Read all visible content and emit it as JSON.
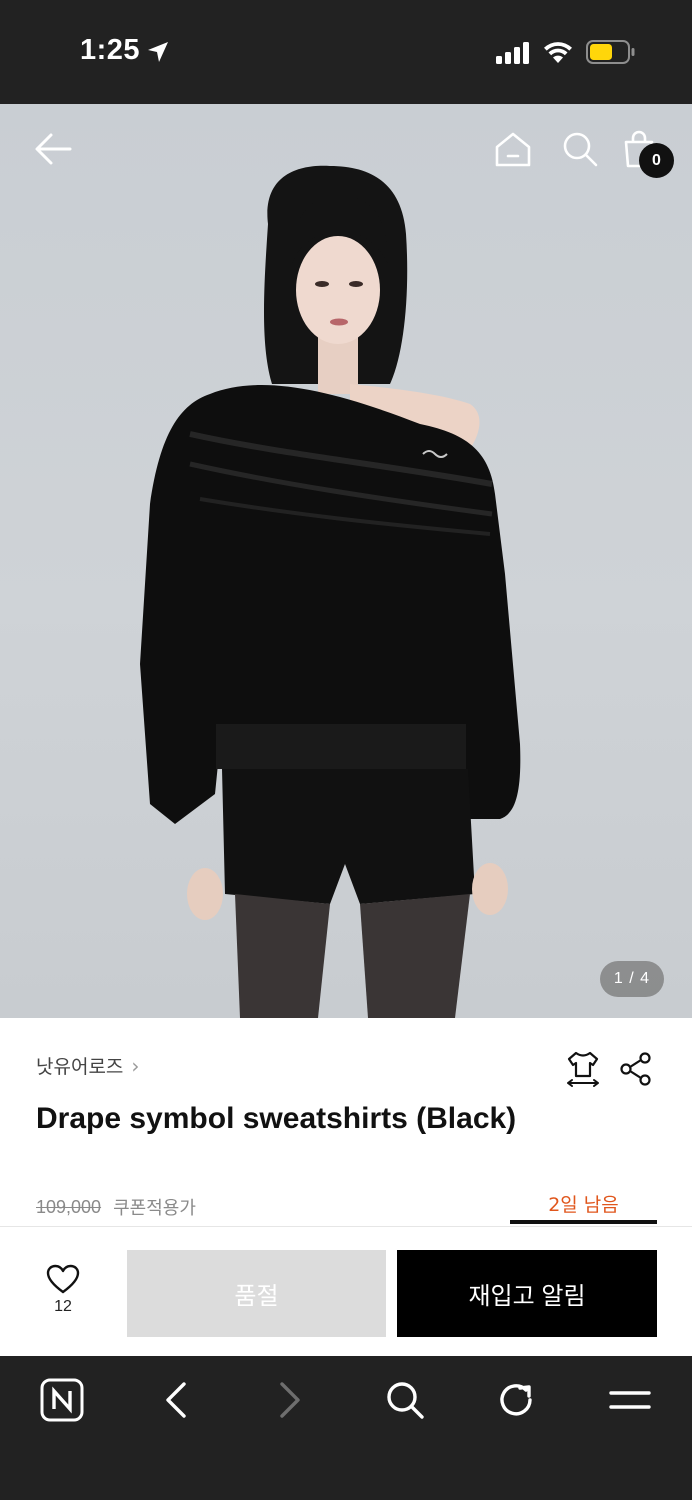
{
  "status_bar": {
    "time": "1:25",
    "icons": [
      "location-arrow-icon",
      "cellular-signal-icon",
      "wifi-icon",
      "battery-icon"
    ],
    "battery_color": "#ffd60a"
  },
  "header": {
    "icons": [
      "back-arrow-icon",
      "home-icon",
      "search-icon",
      "shopping-bag-icon"
    ],
    "cart_count": "0"
  },
  "gallery": {
    "counter": "1 / 4",
    "current": 1,
    "total": 4
  },
  "product": {
    "brand": "낫유어로즈",
    "brand_chevron": "›",
    "title": "Drape symbol sweatshirts (Black)",
    "original_price": "109,000",
    "coupon_label": "쿠폰적용가",
    "days_left": "2일 남음",
    "icons": [
      "size-guide-icon",
      "share-icon"
    ]
  },
  "action_bar": {
    "like_count": "12",
    "soldout_label": "품절",
    "restock_label": "재입고 알림"
  },
  "browser_bar": {
    "icons": [
      "naver-icon",
      "back-chevron-icon",
      "forward-chevron-icon",
      "search-icon",
      "reload-icon",
      "menu-icon"
    ]
  },
  "colors": {
    "accent_orange": "#e0561c",
    "dark_bar": "#222222",
    "soldout_bg": "#dcdcdc",
    "restock_bg": "#000000"
  }
}
